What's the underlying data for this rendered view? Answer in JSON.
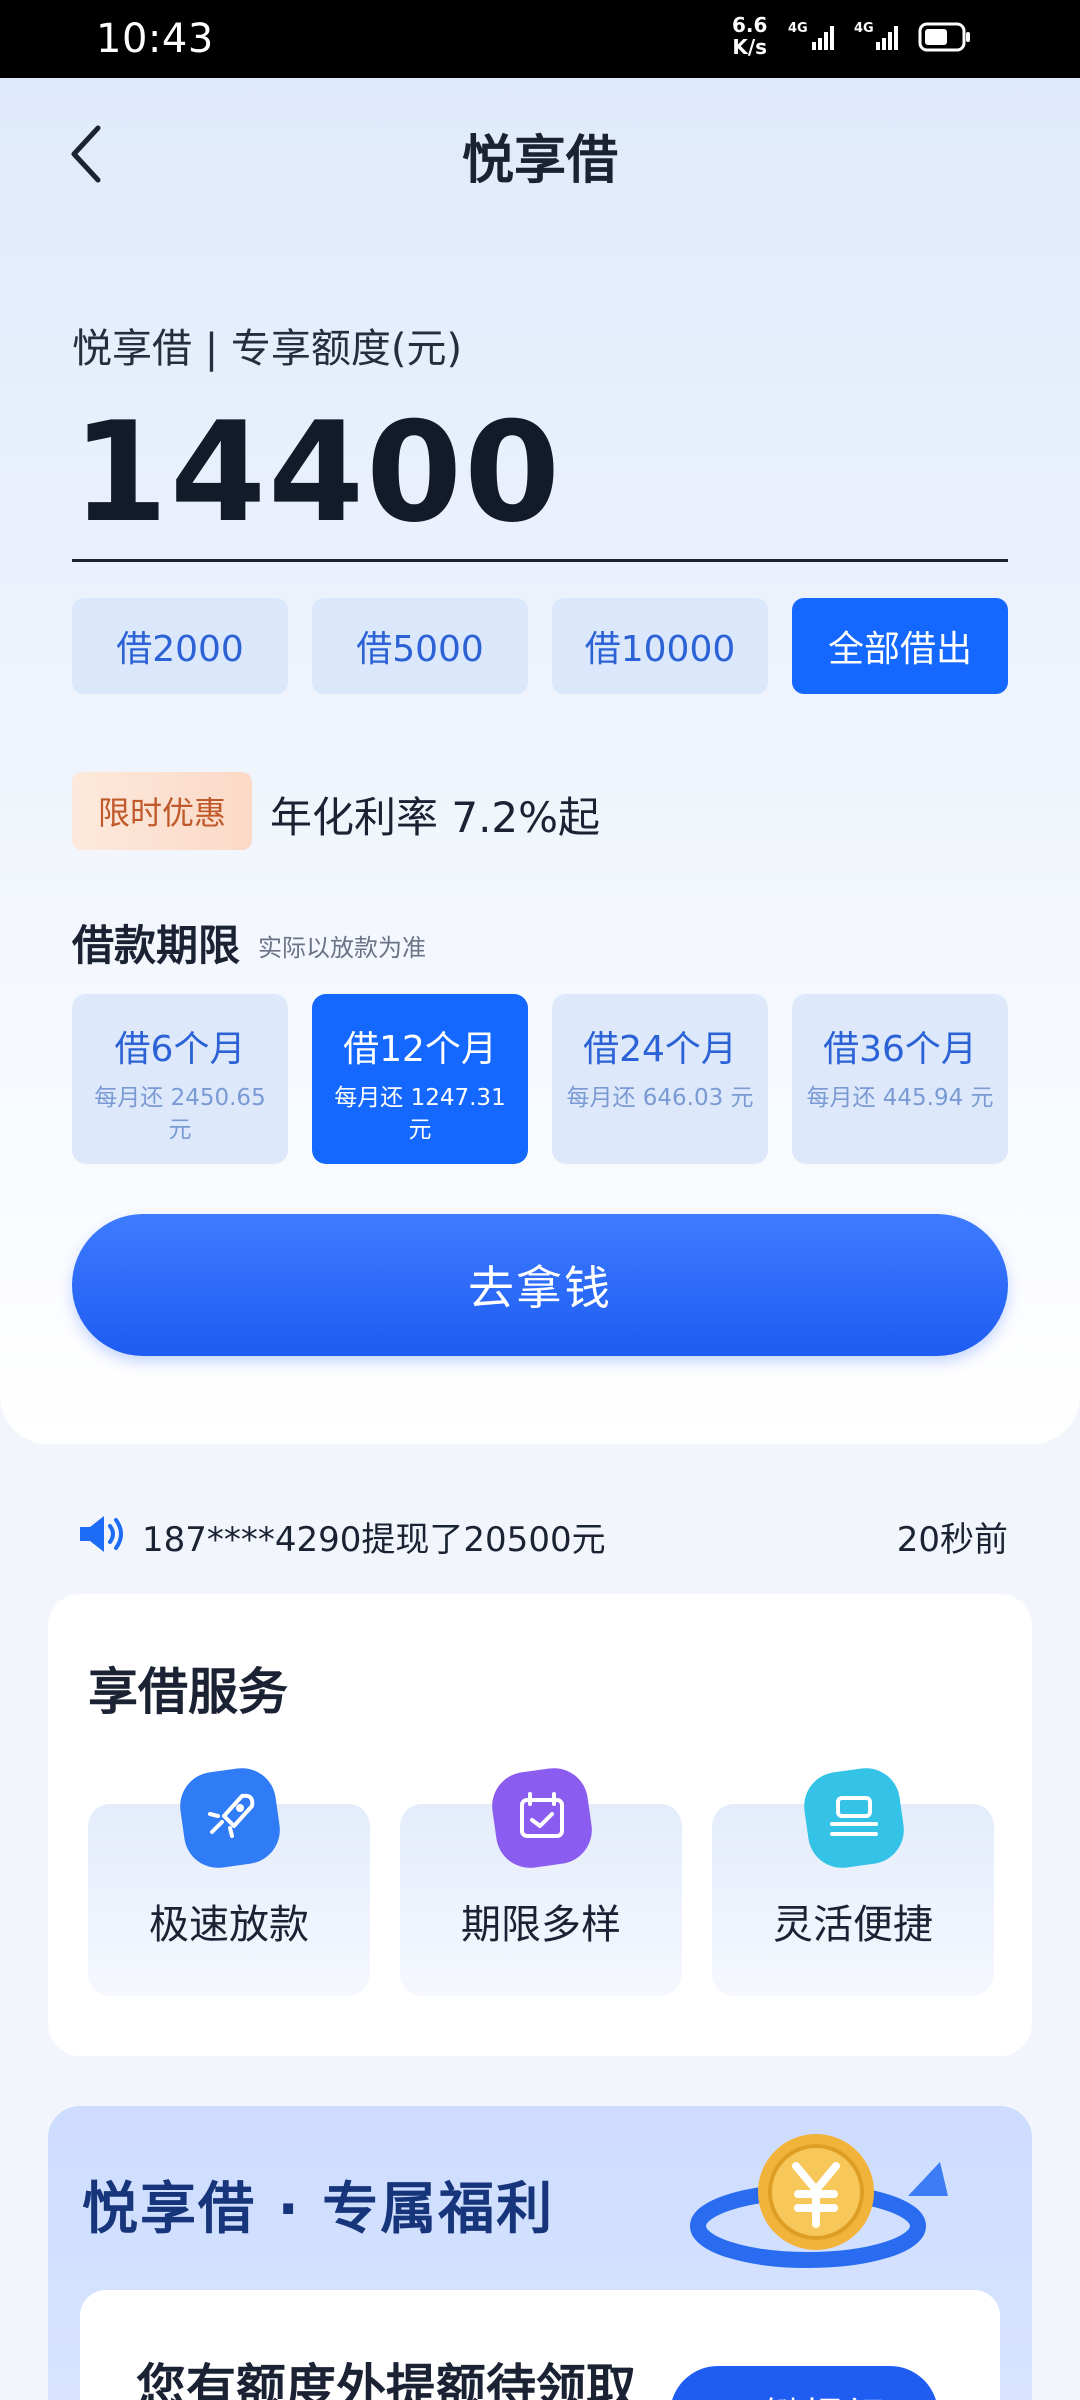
{
  "status_bar": {
    "time": "10:43",
    "net_speed_value": "6.6",
    "net_speed_unit": "K/s",
    "signal1": "4G",
    "signal2": "4G"
  },
  "header": {
    "title": "悦享借",
    "back_icon": "chevron-left-icon"
  },
  "quota": {
    "label": "悦享借 | 专享额度(元)",
    "value": "14400"
  },
  "amount_options": [
    {
      "label": "借2000",
      "selected": false
    },
    {
      "label": "借5000",
      "selected": false
    },
    {
      "label": "借10000",
      "selected": false
    },
    {
      "label": "全部借出",
      "selected": true
    }
  ],
  "promo": {
    "tag": "限时优惠",
    "rate_text": "年化利率 7.2%起"
  },
  "term": {
    "title": "借款期限",
    "note": "实际以放款为准",
    "options": [
      {
        "name": "借6个月",
        "payment": "每月还 2450.65 元",
        "selected": false
      },
      {
        "name": "借12个月",
        "payment": "每月还 1247.31 元",
        "selected": true
      },
      {
        "name": "借24个月",
        "payment": "每月还 646.03 元",
        "selected": false
      },
      {
        "name": "借36个月",
        "payment": "每月还 445.94 元",
        "selected": false
      }
    ]
  },
  "cta": {
    "label": "去拿钱"
  },
  "ticker": {
    "icon": "speaker-icon",
    "text": "187****4290提现了20500元",
    "time": "20秒前"
  },
  "services": {
    "title": "享借服务",
    "items": [
      {
        "label": "极速放款",
        "icon": "rocket-icon",
        "color": "#2f7cf6"
      },
      {
        "label": "期限多样",
        "icon": "calendar-check-icon",
        "color": "#8a5cf0"
      },
      {
        "label": "灵活便捷",
        "icon": "stack-icon",
        "color": "#34c3e6"
      }
    ]
  },
  "benefits": {
    "title": "悦享借 · 专属福利",
    "icon": "yuan-coin-icon",
    "card_text": "您有额度外提额待领取",
    "card_button": "一键提额"
  },
  "colors": {
    "primary": "#1468ff",
    "promo_bg": "#fbd9c6",
    "promo_text": "#c05a2a"
  }
}
